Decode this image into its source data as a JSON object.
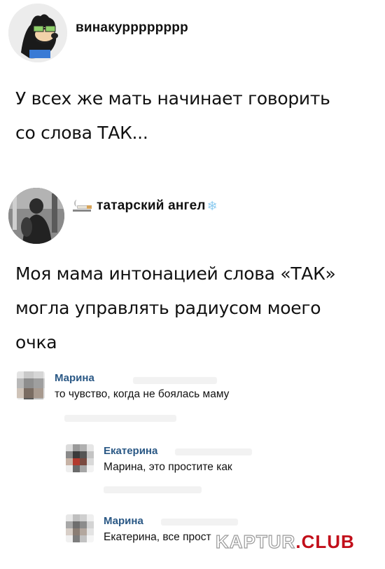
{
  "posts": [
    {
      "author": "винакурррррррр",
      "text_lines": [
        "У всех же мать начинает говорить",
        "со слова ТАК..."
      ],
      "avatar_icon": "cartoon-goofy-sunglasses-avatar"
    },
    {
      "author": "татарский ангел",
      "author_prefix_icon": "cigarette-icon",
      "author_suffix_icon": "snowflake-icon",
      "snowflake_glyph": "❄",
      "text_lines": [
        "Моя мама интонацией слова «ТАК»",
        "могла управлять радиусом моего",
        "очка"
      ],
      "avatar_icon": "photo-avatar"
    }
  ],
  "comments": [
    {
      "name": "Марина",
      "text": "то чувство, когда не боялась маму"
    },
    {
      "name": "Екатерина",
      "text": "Марина, это простите как"
    },
    {
      "name": "Марина",
      "text": "Екатерина, все прост"
    }
  ],
  "watermark": {
    "part1": "KAPTUR",
    "part2": ".CLUB"
  },
  "colors": {
    "comment_name": "#2a5885",
    "watermark_red": "#c20f1a",
    "snowflake": "#8ccbf0"
  }
}
